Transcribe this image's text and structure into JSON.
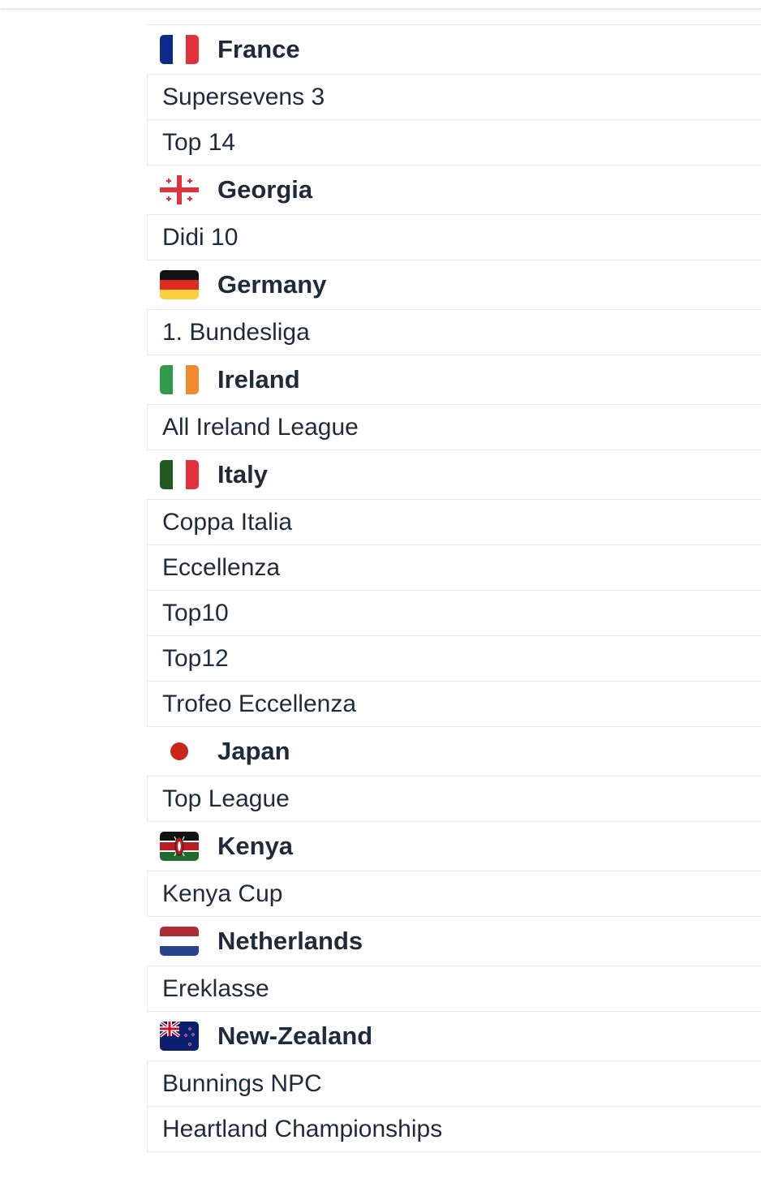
{
  "countries": [
    {
      "name": "France",
      "flag_icon": "france-flag-icon",
      "leagues": [
        "Supersevens 3",
        "Top 14"
      ]
    },
    {
      "name": "Georgia",
      "flag_icon": "georgia-flag-icon",
      "leagues": [
        "Didi 10"
      ]
    },
    {
      "name": "Germany",
      "flag_icon": "germany-flag-icon",
      "leagues": [
        "1. Bundesliga"
      ]
    },
    {
      "name": "Ireland",
      "flag_icon": "ireland-flag-icon",
      "leagues": [
        "All Ireland League"
      ]
    },
    {
      "name": "Italy",
      "flag_icon": "italy-flag-icon",
      "leagues": [
        "Coppa Italia",
        "Eccellenza",
        "Top10",
        "Top12",
        "Trofeo Eccellenza"
      ]
    },
    {
      "name": "Japan",
      "flag_icon": "japan-flag-icon",
      "leagues": [
        "Top League"
      ]
    },
    {
      "name": "Kenya",
      "flag_icon": "kenya-flag-icon",
      "leagues": [
        "Kenya Cup"
      ]
    },
    {
      "name": "Netherlands",
      "flag_icon": "netherlands-flag-icon",
      "leagues": [
        "Ereklasse"
      ]
    },
    {
      "name": "New-Zealand",
      "flag_icon": "new-zealand-flag-icon",
      "leagues": [
        "Bunnings NPC",
        "Heartland Championships"
      ]
    }
  ]
}
